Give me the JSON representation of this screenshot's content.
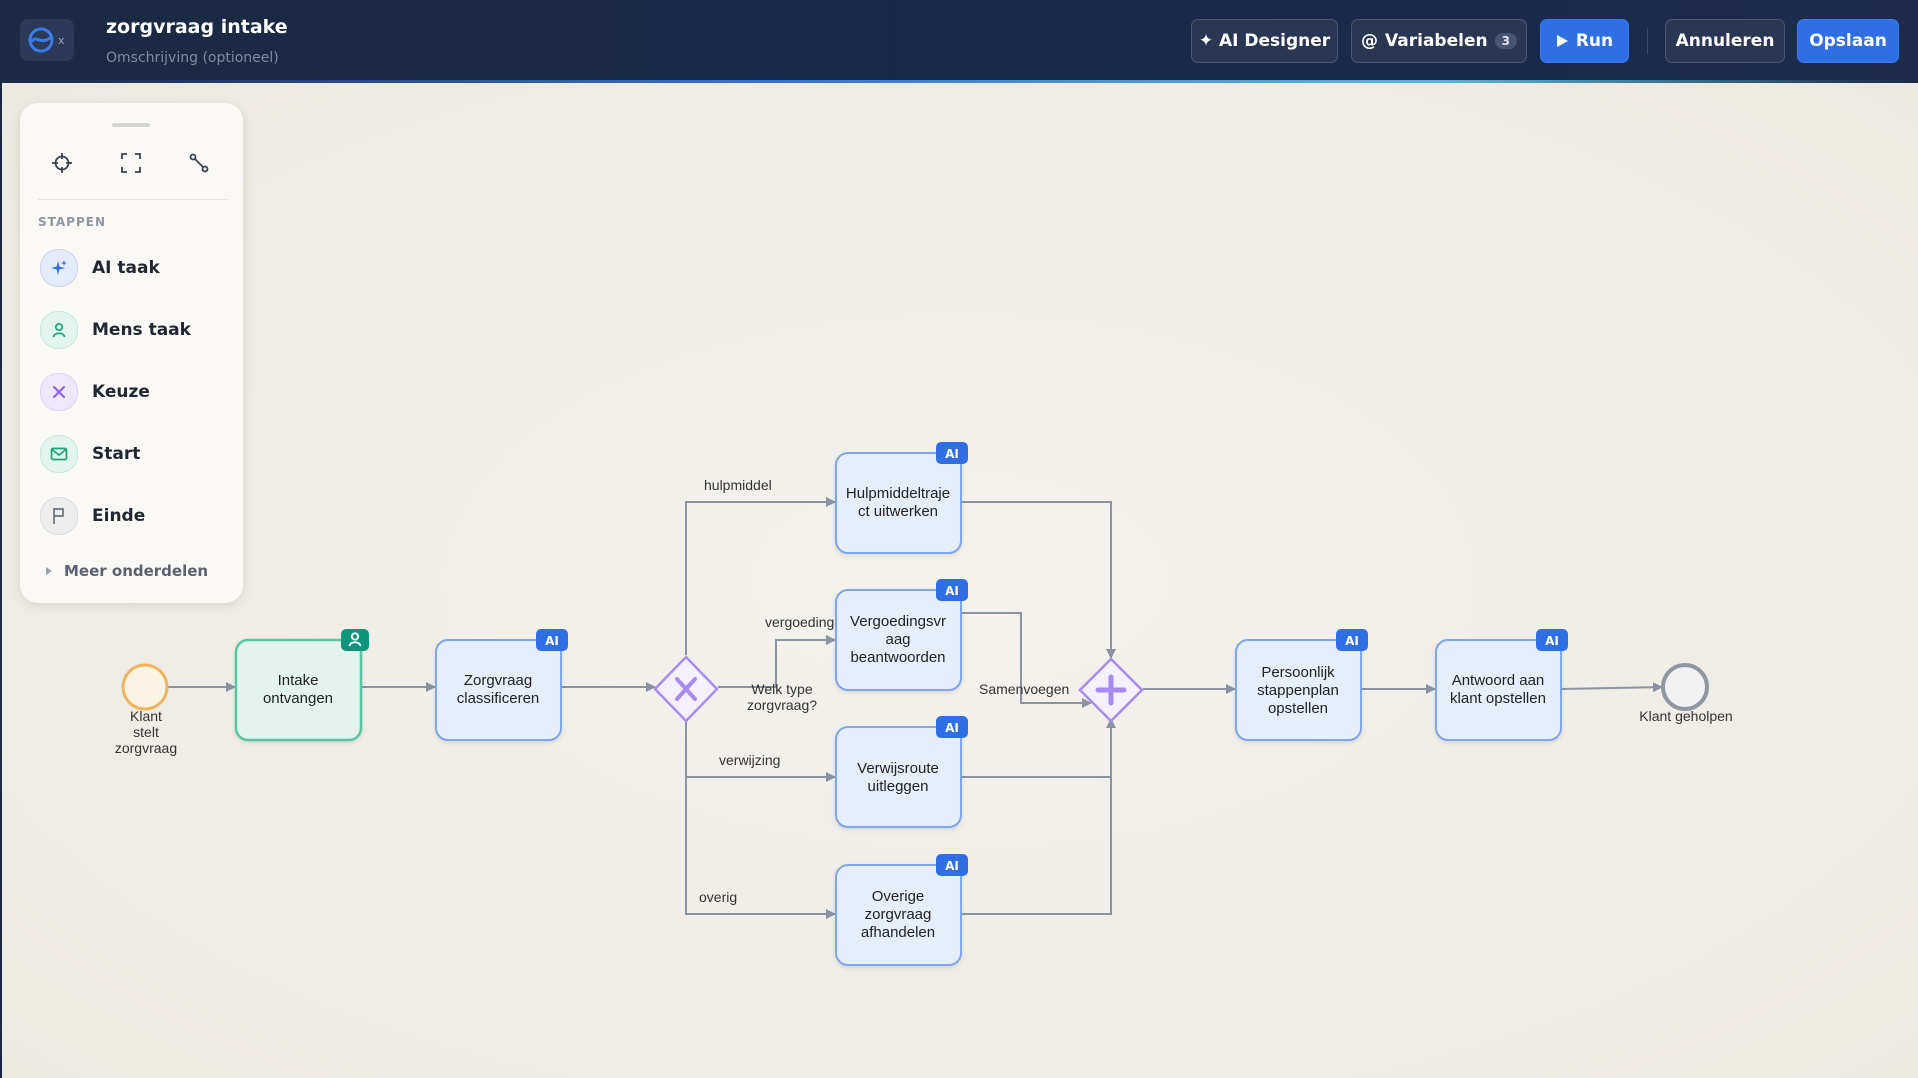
{
  "header": {
    "title": "zorgvraag intake",
    "subtitle": "Omschrijving (optioneel)",
    "logo_suffix": "x",
    "ai_designer_label": "✦ AI Designer",
    "variables_label": "Variabelen",
    "variables_count": "3",
    "variables_prefix": "@",
    "run_label": "Run",
    "cancel_label": "Annuleren",
    "save_label": "Opslaan"
  },
  "palette": {
    "section_label": "STAPPEN",
    "items": [
      {
        "label": "AI taak",
        "icon": "sparkle-icon",
        "color": "#2f6fe6"
      },
      {
        "label": "Mens taak",
        "icon": "person-icon",
        "color": "#1ba37a"
      },
      {
        "label": "Keuze",
        "icon": "close-icon",
        "color": "#8a5cf0"
      },
      {
        "label": "Start",
        "icon": "mail-icon",
        "color": "#1ba37a"
      },
      {
        "label": "Einde",
        "icon": "flag-icon",
        "color": "#6b7280"
      }
    ],
    "more_label": "Meer onderdelen"
  },
  "diagram": {
    "start_event": "Klant\nstelt\nzorgvraag",
    "end_event": "Klant geholpen",
    "gateway_label": "Welk type\nzorgvraag?",
    "join_label": "Samenvoegen",
    "tasks": {
      "intake": "Intake\nontvangen",
      "classify": "Zorgvraag\nclassificeren",
      "hulpmiddel": "Hulpmiddeltraje\nct uitwerken",
      "vergoeding": "Vergoedingsvr\naag\nbeantwoorden",
      "verwijs": "Verwijsroute\nuitleggen",
      "overig": "Overige\nzorgvraag\nafhandelen",
      "stappenplan": "Persoonlijk\nstappenplan\nopstellen",
      "antwoord": "Antwoord aan\nklant opstellen"
    },
    "flows": {
      "hulpmiddel": "hulpmiddel",
      "vergoeding": "vergoeding",
      "verwijzing": "verwijzing",
      "overig": "overig"
    },
    "ai_badge": "AI"
  },
  "colors": {
    "ai_task_fill": "#e7eefb",
    "ai_task_stroke": "#7ea6ec",
    "human_task_fill": "#e3f4ee",
    "human_task_stroke": "#58c7a1",
    "gateway": "#a98af2",
    "start": "#f0b45a",
    "end": "#8f97a3",
    "accent": "#2f6fe6"
  }
}
